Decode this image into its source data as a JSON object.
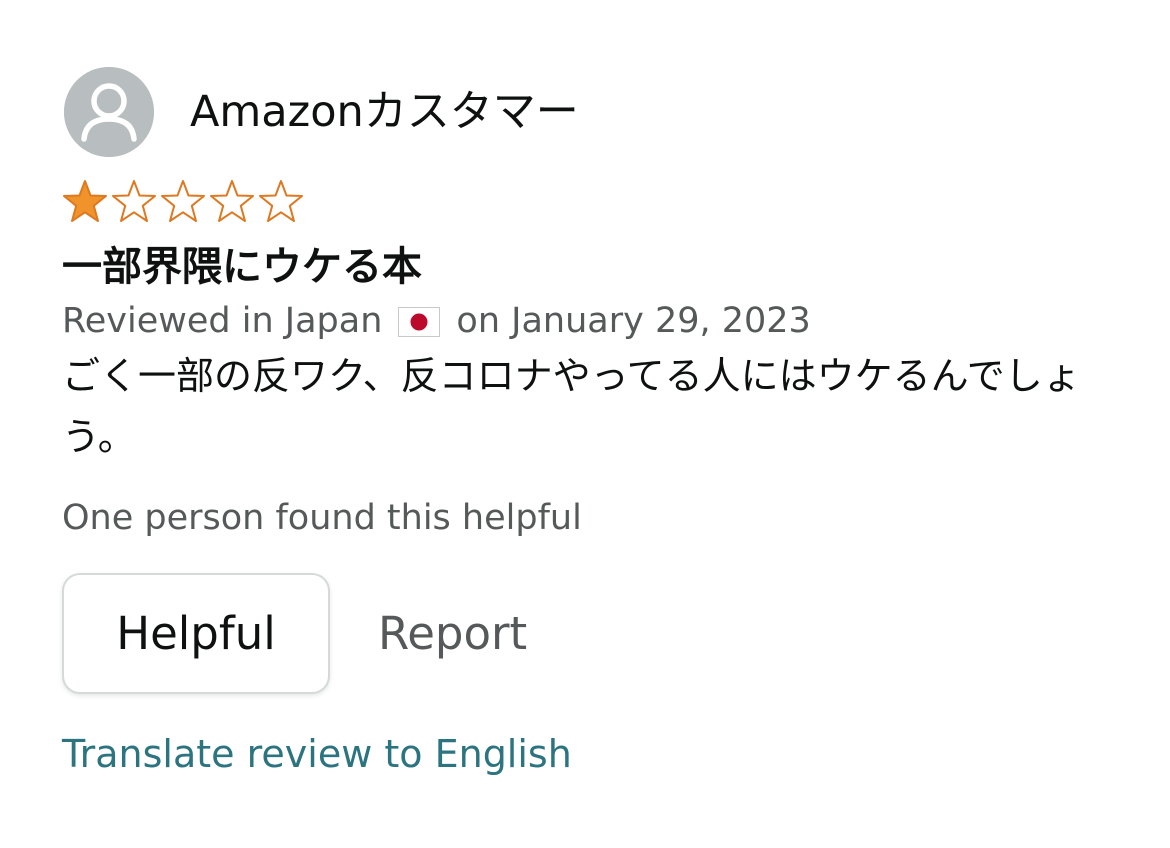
{
  "review": {
    "profile_name": "Amazonカスタマー",
    "rating": 1,
    "rating_max": 5,
    "title": "一部界隈にウケる本",
    "date_prefix": "Reviewed in Japan",
    "date_suffix": "on January 29, 2023",
    "body": "ごく一部の反ワク、反コロナやってる人にはウケるんでしょう。",
    "helpful_count_text": "One person found this helpful",
    "helpful_button_label": "Helpful",
    "report_label": "Report",
    "translate_label": "Translate review to English"
  },
  "icons": {
    "avatar": "person-avatar-icon",
    "star_filled": "star-filled-icon",
    "star_empty": "star-empty-icon",
    "flag": "japan-flag-icon"
  },
  "colors": {
    "star_fill": "#f0932b",
    "star_outline": "#de7921",
    "link": "#2b7480",
    "secondary_text": "#565959",
    "avatar_bg": "#b8bdc0"
  }
}
